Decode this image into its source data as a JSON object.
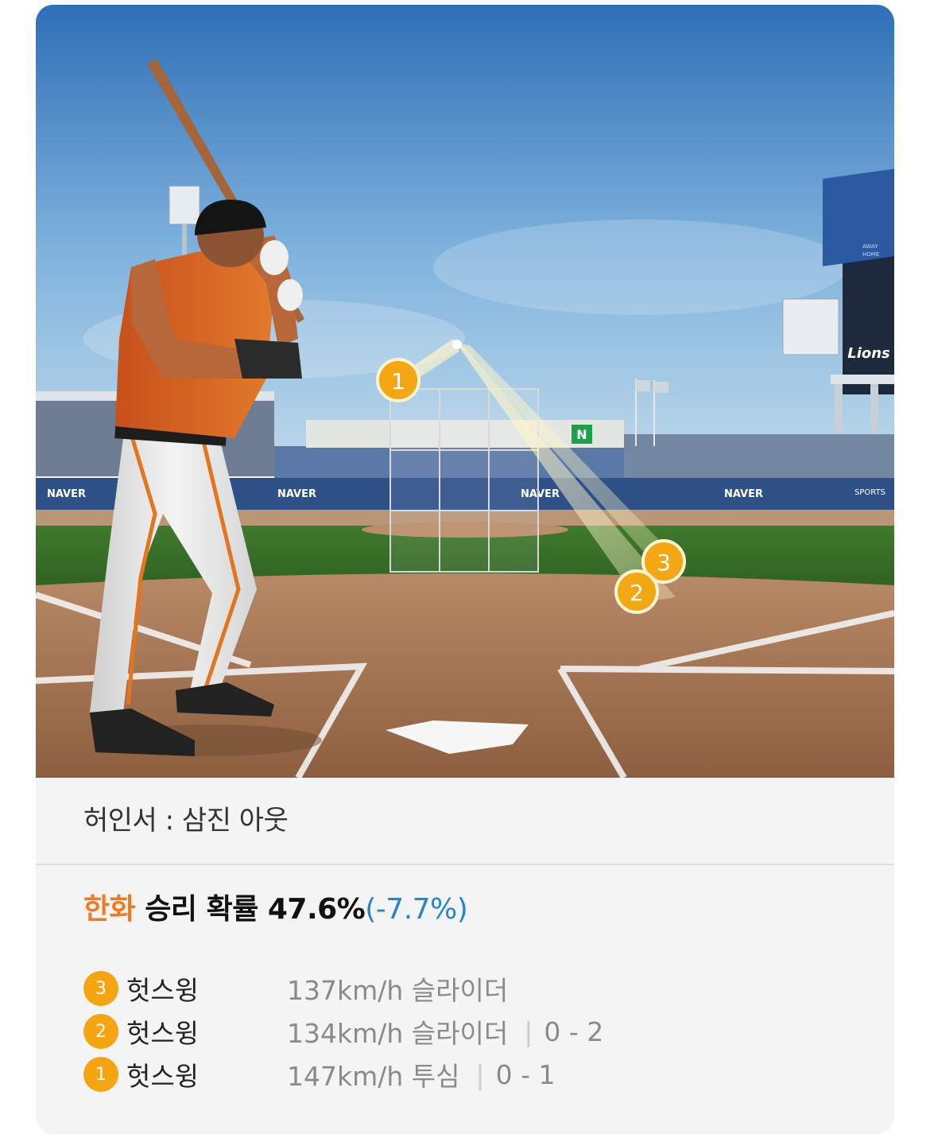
{
  "scene": {
    "banners": [
      "NAVER",
      "NAVER",
      "NAVER",
      "NAVER"
    ],
    "sponsor": "SPORTS",
    "team_logo": "Lions",
    "scoreboard_header": [
      "AWAY",
      "HOME"
    ],
    "pitch_markers": [
      "1",
      "2",
      "3"
    ]
  },
  "result": {
    "text": "허인서 : 삼진 아웃"
  },
  "win_probability": {
    "team": "한화",
    "label": "승리 확률",
    "value": "47.6%",
    "delta": "(-7.7%)"
  },
  "pitches": [
    {
      "number": "3",
      "result": "헛스윙",
      "detail": "137km/h  슬라이더",
      "count": ""
    },
    {
      "number": "2",
      "result": "헛스윙",
      "detail": "134km/h  슬라이더",
      "count": "0 - 2"
    },
    {
      "number": "1",
      "result": "헛스윙",
      "detail": "147km/h  투심",
      "count": "0 - 1"
    }
  ],
  "colors": {
    "team": "#f07c1f",
    "delta": "#2684d6",
    "badge": "#f5a412"
  }
}
